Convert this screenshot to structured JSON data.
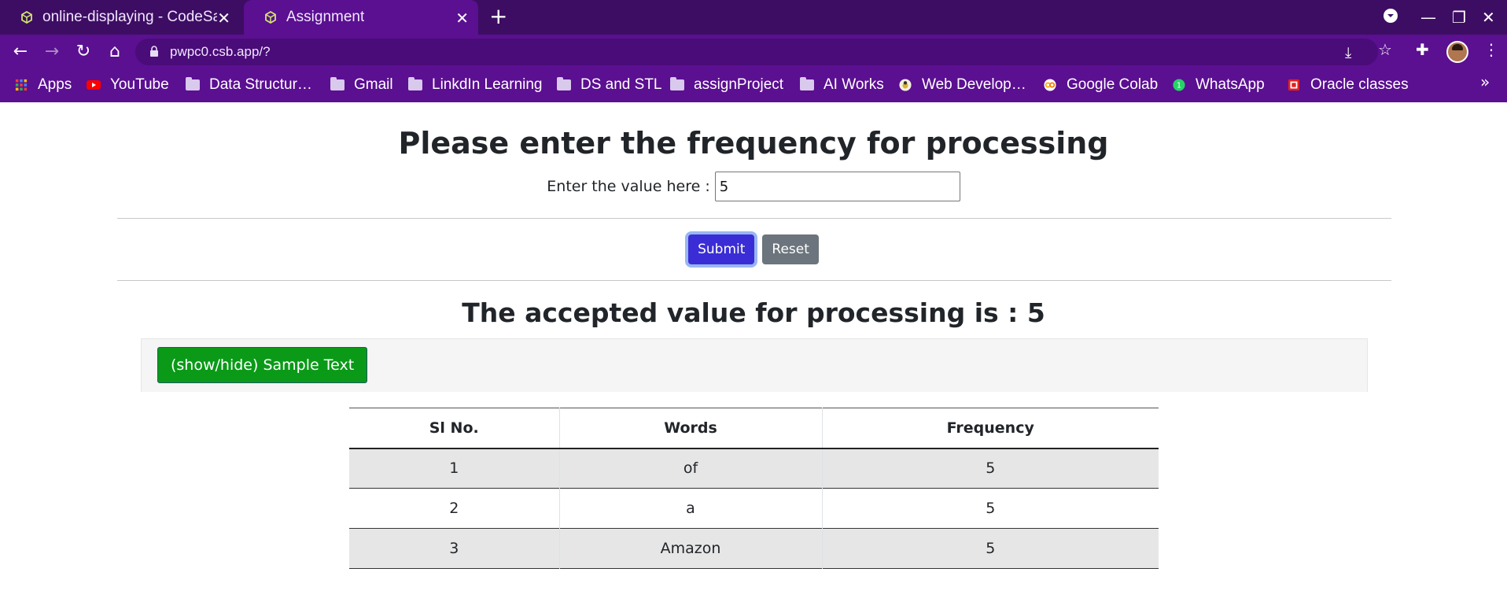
{
  "browser": {
    "tabs": [
      {
        "title": "online-displaying - CodeSandbox",
        "active": false
      },
      {
        "title": "Assignment",
        "active": true
      }
    ],
    "url": "pwpc0.csb.app/?",
    "bookmarks": [
      {
        "label": "Apps",
        "icon": "apps-grid-icon"
      },
      {
        "label": "YouTube",
        "icon": "youtube-icon"
      },
      {
        "label": "Data Structur…",
        "icon": "folder-icon"
      },
      {
        "label": "Gmail",
        "icon": "folder-icon"
      },
      {
        "label": "LinkdIn Learning",
        "icon": "folder-icon"
      },
      {
        "label": "DS and STL",
        "icon": "folder-icon"
      },
      {
        "label": "assignProject",
        "icon": "folder-icon"
      },
      {
        "label": "AI Works",
        "icon": "folder-icon"
      },
      {
        "label": "Web Develop…",
        "icon": "site-icon"
      },
      {
        "label": "Google Colab",
        "icon": "colab-icon"
      },
      {
        "label": "WhatsApp",
        "icon": "whatsapp-icon"
      },
      {
        "label": "Oracle classes",
        "icon": "oracle-icon"
      }
    ],
    "colors": {
      "tabbar": "#3d0d63",
      "toolbar": "#5b0f91"
    }
  },
  "page": {
    "heading": "Please enter the frequency for processing",
    "input_label": "Enter the value here :",
    "input_value": "5",
    "submit_label": "Submit",
    "reset_label": "Reset",
    "accepted_heading": "The accepted value for processing is : 5",
    "toggle_label": "(show/hide) Sample Text",
    "table": {
      "headers": [
        "Sl No.",
        "Words",
        "Frequency"
      ],
      "rows": [
        [
          "1",
          "of",
          "5"
        ],
        [
          "2",
          "a",
          "5"
        ],
        [
          "3",
          "Amazon",
          "5"
        ]
      ]
    },
    "colors": {
      "submit": "#3a2dd6",
      "reset": "#6c757d",
      "toggle": "#0a9a17"
    }
  }
}
